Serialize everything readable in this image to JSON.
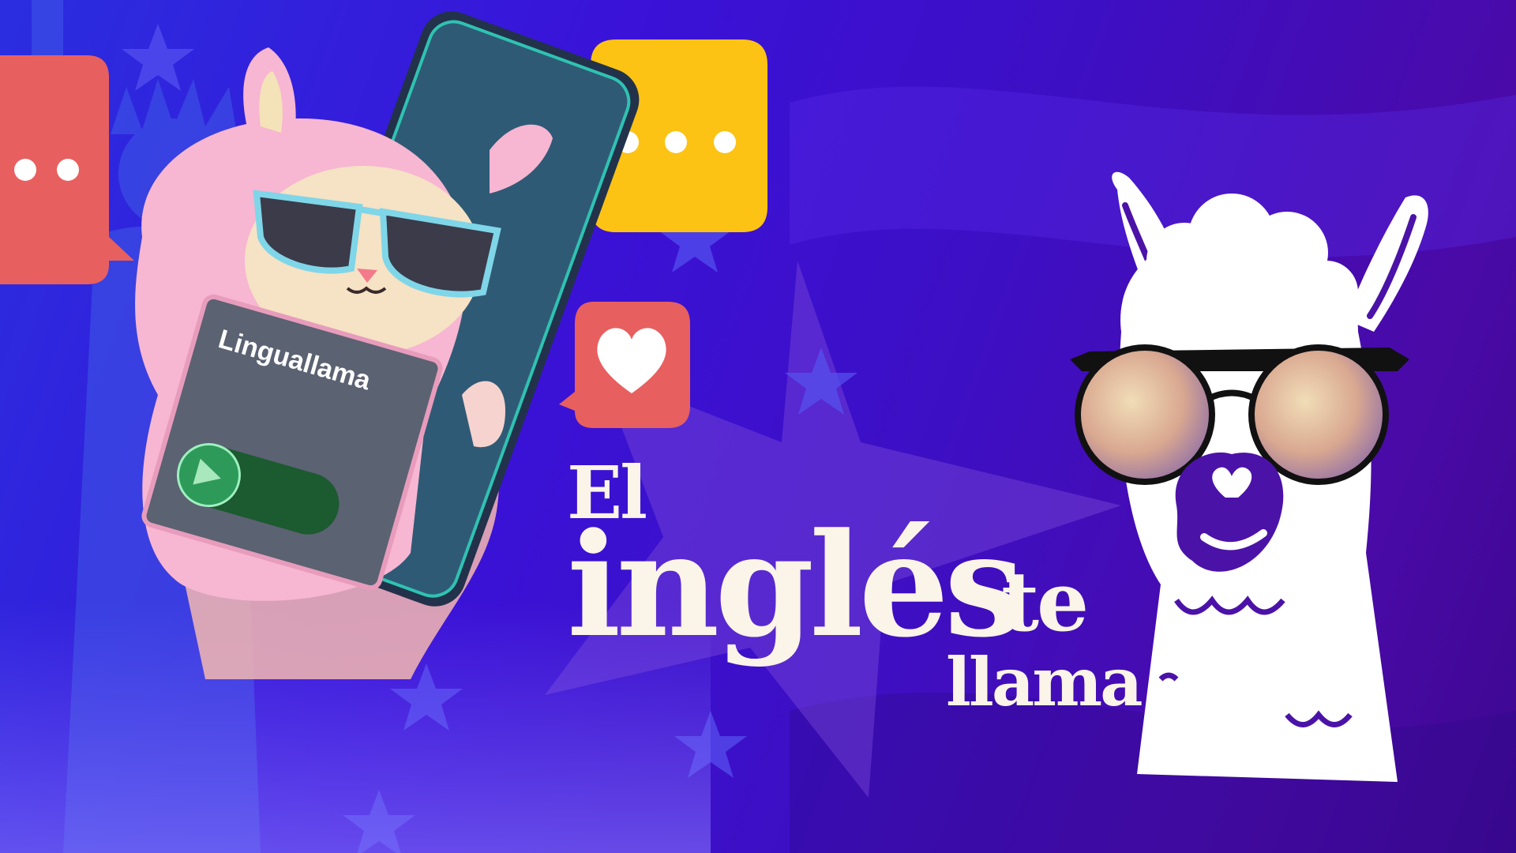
{
  "banner": {
    "headline": {
      "line1": "El",
      "line2": "inglés",
      "line3": "te",
      "line4": "llama"
    },
    "phone": {
      "app_name": "Linguallama"
    },
    "bubbles": [
      {
        "icon": "ellipsis-icon",
        "color": "#e85f5f"
      },
      {
        "icon": "ellipsis-icon",
        "color": "#fcc314"
      },
      {
        "icon": "heart-icon",
        "color": "#e85f5f"
      }
    ]
  },
  "colors": {
    "background_left": "#2a2ee0",
    "background_right": "#4a0aa8",
    "headline": "#fbf4e8",
    "llama_accent": "#4b12a8",
    "pink_llama": "#f7b6d2"
  }
}
